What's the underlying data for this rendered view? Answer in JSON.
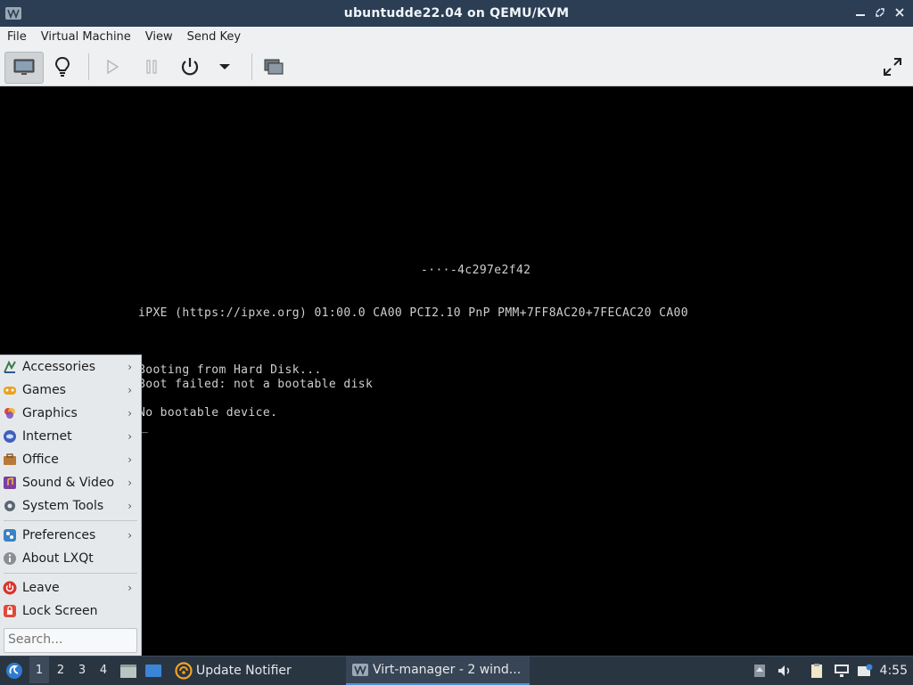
{
  "window": {
    "title": "ubuntudde22.04 on QEMU/KVM"
  },
  "menubar": {
    "items": [
      "File",
      "Virtual Machine",
      "View",
      "Send Key"
    ]
  },
  "console": {
    "lines": [
      "-···-4c297e2f42",
      "iPXE (https://ipxe.org) 01:00.0 CA00 PCI2.10 PnP PMM+7FF8AC20+7FECAC20 CA00",
      "Booting from Hard Disk...",
      "Boot failed: not a bootable disk",
      "No bootable device.",
      "_"
    ]
  },
  "start_menu": {
    "items": [
      {
        "label": "Accessories",
        "icon": "accessories-icon",
        "submenu": true
      },
      {
        "label": "Games",
        "icon": "games-icon",
        "submenu": true
      },
      {
        "label": "Graphics",
        "icon": "graphics-icon",
        "submenu": true
      },
      {
        "label": "Internet",
        "icon": "internet-icon",
        "submenu": true
      },
      {
        "label": "Office",
        "icon": "office-icon",
        "submenu": true
      },
      {
        "label": "Sound & Video",
        "icon": "sound-video-icon",
        "submenu": true
      },
      {
        "label": "System Tools",
        "icon": "system-tools-icon",
        "submenu": true
      },
      {
        "label": "Preferences",
        "icon": "preferences-icon",
        "submenu": true
      },
      {
        "label": "About LXQt",
        "icon": "about-icon",
        "submenu": false
      },
      {
        "label": "Leave",
        "icon": "leave-icon",
        "submenu": true
      },
      {
        "label": "Lock Screen",
        "icon": "lock-icon",
        "submenu": false
      }
    ],
    "search_placeholder": "Search...",
    "arrow": "›"
  },
  "taskbar": {
    "desktops": [
      "1",
      "2",
      "3",
      "4"
    ],
    "tasks": [
      {
        "label": "Update Notifier"
      },
      {
        "label": "Virt-manager - 2 wind..."
      }
    ],
    "clock": "4:55"
  },
  "colors": {
    "titlebar": "#2b3e54",
    "taskbar": "#2a3542",
    "menu_bg": "#e6e9ec"
  }
}
